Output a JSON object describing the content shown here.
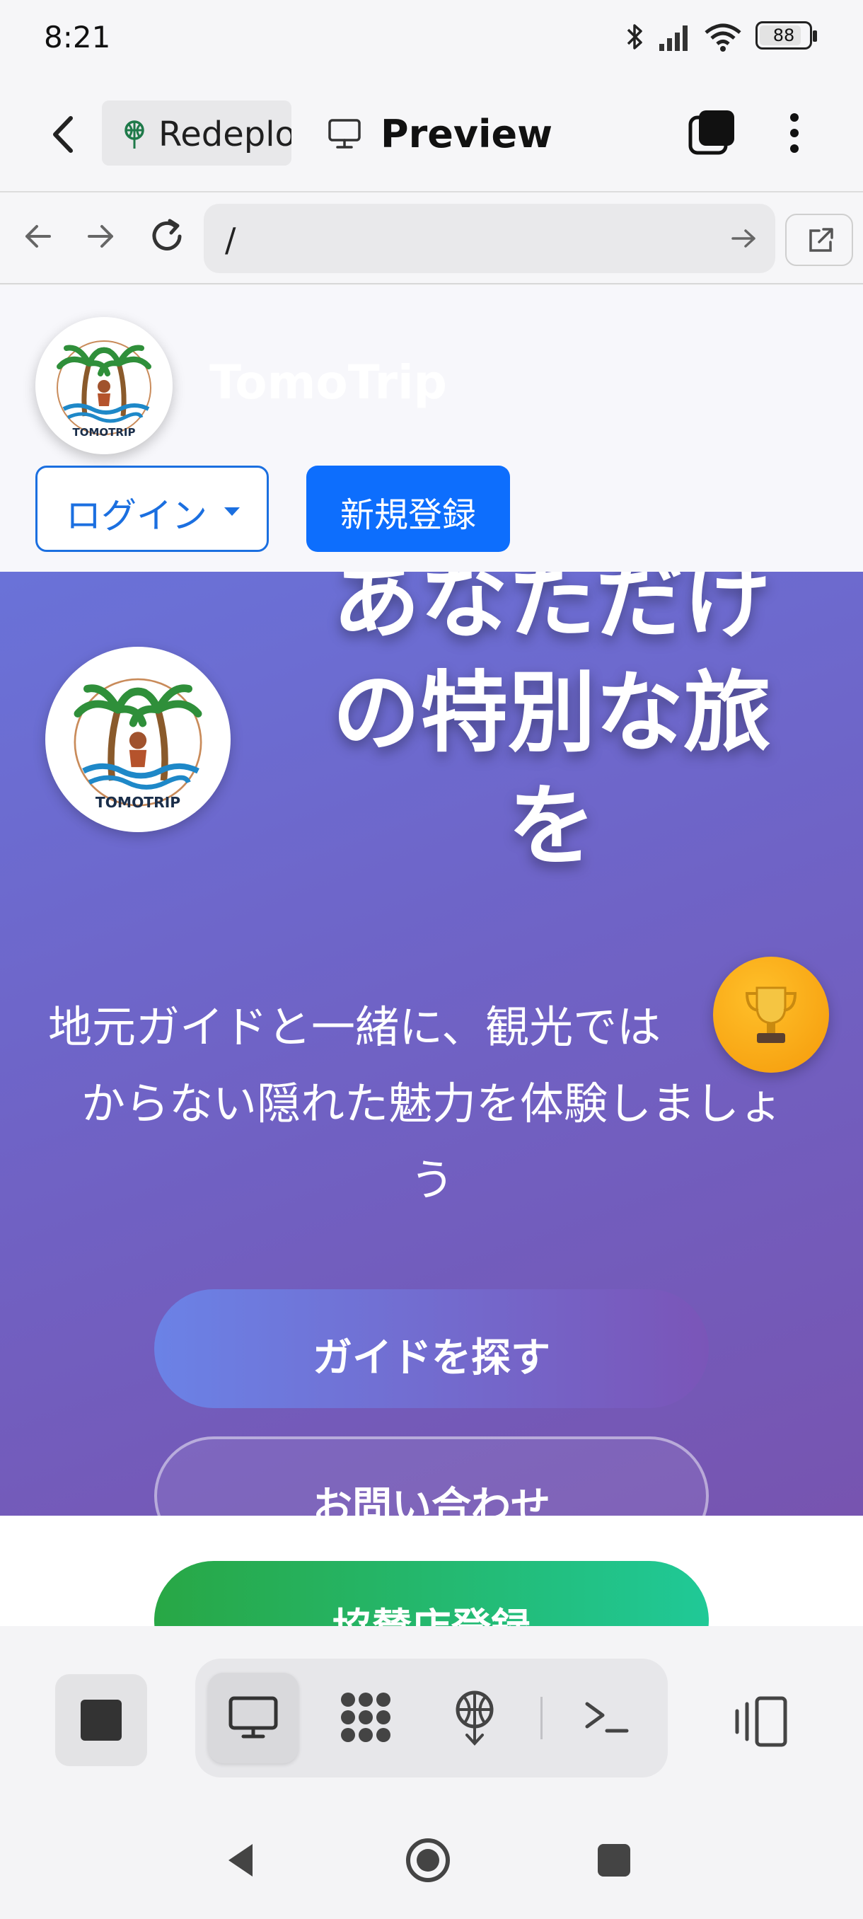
{
  "status_bar": {
    "time": "8:21",
    "battery": "88"
  },
  "app_header": {
    "tab_redeploy_label": "Redeplo",
    "tab_preview_label": "Preview"
  },
  "url_bar": {
    "value": "/"
  },
  "site": {
    "name": "TomoTrip",
    "logo_text": "TOMOTRIP",
    "login_label": "ログイン",
    "signup_label": "新規登録"
  },
  "hero": {
    "title_line1": "あなただけ",
    "title_line2": "の特別な旅",
    "title_line3": "を",
    "subtitle_line1": "地元ガイドと一緒に、観光では",
    "subtitle_line2": "からない隠れた魅力を体験しましょ",
    "subtitle_line3": "う",
    "find_guide_label": "ガイドを探す",
    "contact_label": "お問い合わせ",
    "sponsor_label": "協賛店登録"
  },
  "colors": {
    "hero_gradient_start": "#6a72d8",
    "hero_gradient_end": "#7754b0",
    "primary_blue": "#0d6efd",
    "sponsor_green": "#28a745",
    "trophy_orange": "#f5a10f"
  }
}
